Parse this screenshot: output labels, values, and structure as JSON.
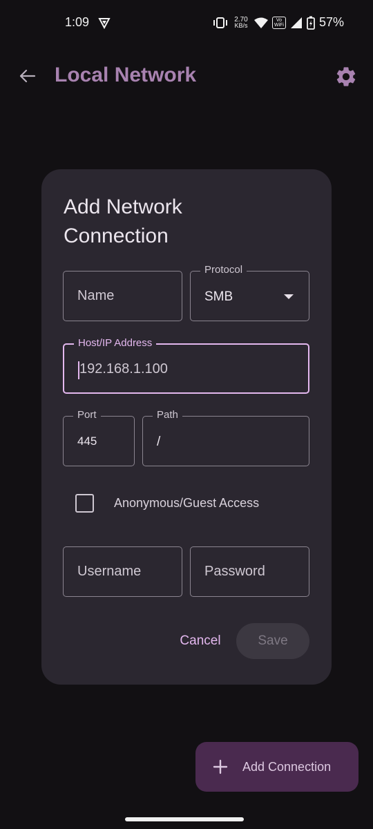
{
  "status_bar": {
    "time": "1:09",
    "speed_value": "2.70",
    "speed_unit": "KB/s",
    "vowifi_top": "Vo",
    "vowifi_bottom": "WiFi",
    "battery": "57%"
  },
  "app_bar": {
    "title": "Local Network",
    "back_icon": "arrow-left-icon",
    "settings_icon": "gear-icon"
  },
  "dialog": {
    "title": "Add Network Connection",
    "name_field": {
      "placeholder": "Name",
      "value": ""
    },
    "protocol_field": {
      "label": "Protocol",
      "value": "SMB"
    },
    "host_field": {
      "label": "Host/IP Address",
      "placeholder": "192.168.1.100",
      "value": ""
    },
    "port_field": {
      "label": "Port",
      "value": "445"
    },
    "path_field": {
      "label": "Path",
      "value": "/"
    },
    "anonymous_checkbox": {
      "label": "Anonymous/Guest Access",
      "checked": false
    },
    "username_field": {
      "placeholder": "Username",
      "value": ""
    },
    "password_field": {
      "placeholder": "Password",
      "value": ""
    },
    "cancel_label": "Cancel",
    "save_label": "Save"
  },
  "fab": {
    "label": "Add Connection",
    "icon": "plus-icon"
  },
  "colors": {
    "background": "#121013",
    "accent": "#e4b8ef",
    "title": "#a882b0",
    "dialog_surface": "#2b2730",
    "fab_background": "#4a2a4f"
  }
}
